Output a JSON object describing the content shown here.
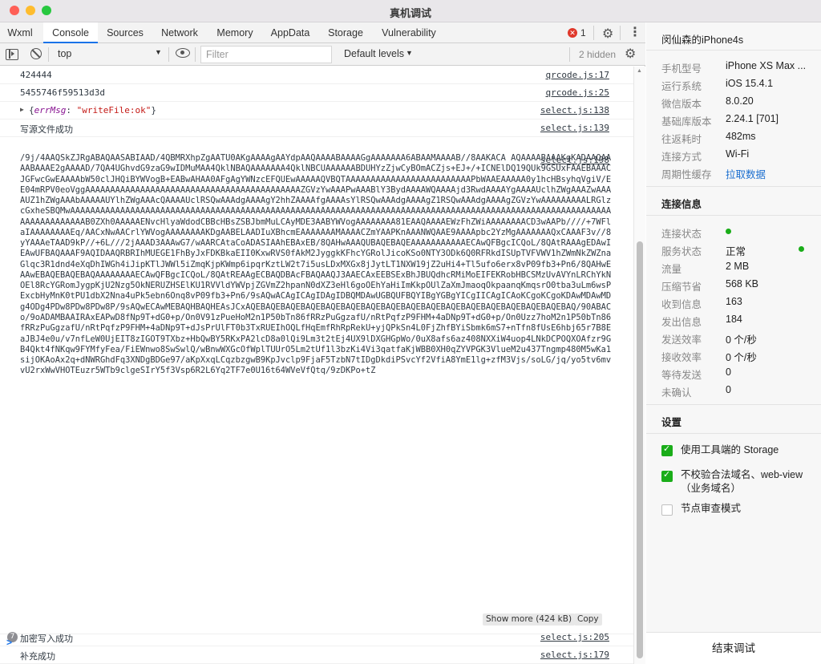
{
  "window": {
    "title": "真机调试"
  },
  "tabs": [
    "Wxml",
    "Console",
    "Sources",
    "Network",
    "Memory",
    "AppData",
    "Storage",
    "Vulnerability"
  ],
  "error_count": "1",
  "toolbar": {
    "context": "top",
    "filter_placeholder": "Filter",
    "levels": "Default levels",
    "hidden": "2 hidden"
  },
  "console": {
    "rows": [
      {
        "text": "424444",
        "link": "qrcode.js:17"
      },
      {
        "text": "5455746f59513d3d",
        "link": "qrcode.js:25"
      },
      {
        "text_key": "errMsg",
        "text_val": "\"writeFile:ok\"",
        "link": "select.js:138"
      },
      {
        "text": "写源文件成功",
        "link": "select.js:139"
      }
    ],
    "b64_link": "select.js:198",
    "b64_text": "/9j/4AAQSkZJRgABAQAASABIAAD/4QBMRXhpZgAATU0AKgAAAAgAAYdpAAQAAAABAAAAGgAAAAAAA6ABAAMAAAAB//8AAKACA AQAAAABAAAKgKADAAQAAAABAAAE2gAAAAD/7QA4UGhvdG9zaG9wIDMuMAA4QklNBAQAAAAAAA4QklNBCUAAAAAABDUHYzZjwCyBOmACZjs+EJ+/+ICNElDQ19QUk9GSUxFAAEBAAACJGFwcGwEAAAAbW50clJHQiBYWVogB+EABwAHAA0AFgAgYWNzcEFQUEwAAAAAQVBQTAAAAAAAAAAAAAAAAAAAAAAAAAPbWAAEAAAAA0y1hcHBsyhqVgiV/EE04mRPV0eoVggAAAAAAAAAAAAAAAAAAAAAAAAAAAAAAAAAAAAAAAAAAAZGVzYwAAAPwAAABlY3BydAAAAWQAAAAjd3RwdAAAAYgAAAAUclhZWgAAAZwAAAAUZ1hZWgAAAbAAAAAUYlhZWgAAAcQAAAAUclRSQwAAAdgAAAAgY2hhZAAAAfgAAAAsYlRSQwAAAdgAAAAgZ1RSQwAAAdgAAAAgZGVzYwAAAAAAAAALRGlzcGxheSBQMwAAAAAAAAAAAAAAAAAAAAAAAAAAAAAAAAAAAAAAAAAAAAAAAAAAAAAAAAAAAAAAAAAAAAAAAAAAAAAAAAAAAAAAAAAAAAAAAAAAAAAAAAAAAAAAAAAAAAAAAAAB0ZXh0AAAAAENvcHlyaWdodCBBcHBsZSBJbmMuLCAyMDE3AABYWVogAAAAAAAA81EAAQAAAAEWzFhZWiAAAAAAAACD3wAAPb////+7WFlaIAAAAAAAAEq/AACxNwAACrlYWVogAAAAAAAAKDgAABELAADIuXBhcmEAAAAAAAMAAAACZmYAAPKnAAANWQAAE9AAAApbc2YzMgAAAAAAAQxCAAAF3v//8yYAAAeTAAD9kP//+6L///2jAAAD3AAAwG7/wAARCAtaCoADASIAAhEBAxEB/8QAHwAAAQUBAQEBAQEAAAAAAAAAAAECAwQFBgcICQoL/8QAtRAAAgEDAwIEAwUFBAQAAAF9AQIDAAQRBRIhMUEGE1FhByJxFDKBkaEII0KxwRVS0fAkM2JyggkKFhcYGRolJicoKSo0NTY3ODk6Q0RFRkdISUpTVFVWV1hZWmNkZWZnaGlqc3R1dnd4eXqDhIWGh4iJipKTlJWWl5iZmqKjpKWmp6ipqrKztLW2t7i5usLDxMXGx8jJytLT1NXW19jZ2uHi4+Tl5ufo6erx8vP09fb3+Pn6/8QAHwEAAwEBAQEBAQEBAQAAAAAAAAECAwQFBgcICQoL/8QAtREAAgECBAQDBAcFBAQAAQJ3AAECAxEEBSExBhJBUQdhcRMiMoEIFEKRobHBCSMzUvAVYnLRChYkNOEl8RcYGRomJygpKjU2Nzg5OkNERUZHSElKU1RVVldYWVpjZGVmZ2hpanN0dXZ3eHl6goOEhYaHiImKkpOUlZaXmJmaoqOkpaanqKmqsrO0tba3uLm6wsPExcbHyMnK0tPU1dbX2Nna4uPk5ebn6Onq8vP09fb3+Pn6/9sAQwACAgICAgIDAgIDBQMDAwUGBQUFBQYIBgYGBgYICgIICAgICAoKCgoKCgoKDAwMDAwMDg4ODg4PDw8PDw8PDw8P/9sAQwECAwMEBAQHBAQHEAsJCxAQEBAQEBAQEBAQEBAQEBAQEBAQEBAQEBAQEBAQEBAQEBAQEBAQEBAQEBAQEBAQEBAQ/90ABACo/9oADAMBAAIRAxEAPwD8fNp9T+dG0+p/On0V91zPueHoM2n1P50bTn86fRRzPuGgzafU/nRtPqfzP9FHM+4aDNp9T+dG0+p/On0Uzz7hoM2n1P50bTn86fRRzPuGgzafU/nRtPqfzP9FHM+4aDNp9T+dJsPrUlFT0b3TxRUEIhOQLfHqEmfRhRpRekU+yjQPkSn4L0FjZhfBYiSbmk6mS7+nTfn8fU",
    "b64_tail": "sE6hbj65r7B8EaJBJ4e0u/v7nfLeW0UjEIT8zIGOT9TXbz+HbQwBY5RKxPA2lcD8a0lQi9Lm3t2tEj4UX9lDXGHGpWo/0uX8afs6az408NXXiW4uop4LNkDCPOQXOAfzr9GB4Qkt4fNKqw9FYMfyFea/FiEWnwo8SwSwlQ/wBnwWXGcOfWplTUUrO5Lm2tUf1l3bzKi4Vi3qatfaKjWBB0XH0qZYVPGK3VlueM2u437Tngmp480M5wKa1sijOKAoAx2q+dNWRGhdFq3XNDgBDGe97/aKpXxqLCqzbzgwB9KpJvclp9FjaF5TzbN7tIDgDkdiPSvcYf2VfiA8YmE1lg+zfM3Vjs/soLG/jq/yo5tv6mvvU2rxWwVHOTEuzr5WTb9clgeSIrY5f3Vsp6R2L6Yq2TF7e0U16t64WVeVfQtq/9zDKPo+tZ"
  },
  "bottom_rows": [
    {
      "text": "加密写入成功",
      "link": "select.js:205",
      "badge": "7"
    },
    {
      "text": "补充成功",
      "link": "select.js:179"
    }
  ],
  "show_more": "Show more (424 kB)",
  "copy_label": "Copy",
  "prompt": ">",
  "device": {
    "name": "闵仙森的iPhone4s",
    "info": [
      {
        "k": "手机型号",
        "v": "iPhone XS Max ..."
      },
      {
        "k": "运行系统",
        "v": "iOS 15.4.1"
      },
      {
        "k": "微信版本",
        "v": "8.0.20"
      },
      {
        "k": "基础库版本",
        "v": "2.24.1 [701]"
      },
      {
        "k": "往返耗时",
        "v": "482ms"
      },
      {
        "k": "连接方式",
        "v": "Wi-Fi"
      },
      {
        "k": "周期性缓存",
        "v": "拉取数据"
      }
    ]
  },
  "conn": {
    "title": "连接信息",
    "items": [
      {
        "k": "连接状态",
        "v": ""
      },
      {
        "k": "服务状态",
        "v": "正常"
      },
      {
        "k": "流量",
        "v": "2 MB"
      },
      {
        "k": "压缩节省",
        "v": "568 KB"
      },
      {
        "k": "收到信息",
        "v": "163"
      },
      {
        "k": "发出信息",
        "v": "184"
      },
      {
        "k": "发送效率",
        "v": "0 个/秒"
      },
      {
        "k": "接收效率",
        "v": "0 个/秒"
      },
      {
        "k": "等待发送",
        "v": "0"
      },
      {
        "k": "未确认",
        "v": "0"
      }
    ]
  },
  "settings": {
    "title": "设置",
    "items": [
      {
        "label": "使用工具端的 Storage",
        "checked": true
      },
      {
        "label": "不校验合法域名、web-view（业务域名）",
        "checked": true
      },
      {
        "label": "节点审查模式",
        "checked": false
      }
    ]
  },
  "end_button": "结束调试",
  "colors": {
    "accent": "#1a73e8",
    "green": "#1aad19",
    "link_blue": "#1a6ecf",
    "error_red": "#e0382b"
  }
}
